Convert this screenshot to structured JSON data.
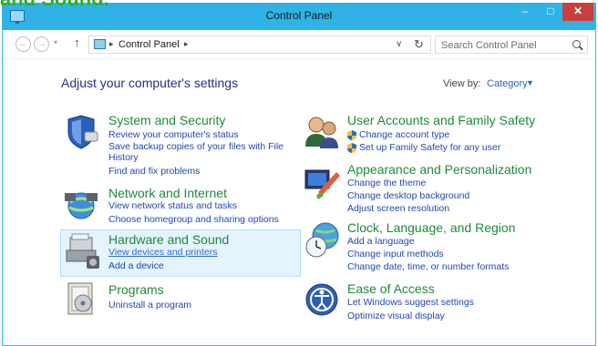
{
  "caption": "and Sound.",
  "window": {
    "title": "Control Panel"
  },
  "window_buttons": {
    "minimize": "–",
    "maximize": "□",
    "close": "✕"
  },
  "nav": {
    "back": "←",
    "forward": "→",
    "recent": "▾",
    "up": "↑"
  },
  "address": {
    "crumb": "Control Panel",
    "separator": "▸",
    "dropdown": "∨",
    "refresh": "↻"
  },
  "search": {
    "placeholder": "Search Control Panel"
  },
  "page": {
    "title": "Adjust your computer's settings",
    "view_by_label": "View by:",
    "view_by_value": "Category",
    "view_by_caret": "▼"
  },
  "categories": [
    {
      "title": "System and Security",
      "icon": "system-security-icon",
      "links": [
        "Review your computer's status",
        "Save backup copies of your files with File",
        "History",
        "Find and fix problems"
      ]
    },
    {
      "title": "Network and Internet",
      "icon": "network-internet-icon",
      "links": [
        "View network status and tasks",
        "Choose homegroup and sharing options"
      ]
    },
    {
      "title": "Hardware and Sound",
      "icon": "hardware-sound-icon",
      "links": [
        "View devices and printers",
        "Add a device"
      ]
    },
    {
      "title": "Programs",
      "icon": "programs-icon",
      "links": [
        "Uninstall a program"
      ]
    },
    {
      "title": "User Accounts and Family Safety",
      "icon": "user-accounts-icon",
      "links": [
        "Change account type",
        "Set up Family Safety for any user"
      ]
    },
    {
      "title": "Appearance and Personalization",
      "icon": "appearance-icon",
      "links": [
        "Change the theme",
        "Change desktop background",
        "Adjust screen resolution"
      ]
    },
    {
      "title": "Clock, Language, and Region",
      "icon": "clock-language-icon",
      "links": [
        "Add a language",
        "Change input methods",
        "Change date, time, or number formats"
      ]
    },
    {
      "title": "Ease of Access",
      "icon": "ease-of-access-icon",
      "links": [
        "Let Windows suggest settings",
        "Optimize visual display"
      ]
    }
  ],
  "colors": {
    "title_bar": "#2fb3e6",
    "close_button": "#c7403c",
    "category_title": "#1f8a3b",
    "link": "#1f47b8",
    "page_title": "#1e3287",
    "hover_bg": "#e4f3fc"
  }
}
